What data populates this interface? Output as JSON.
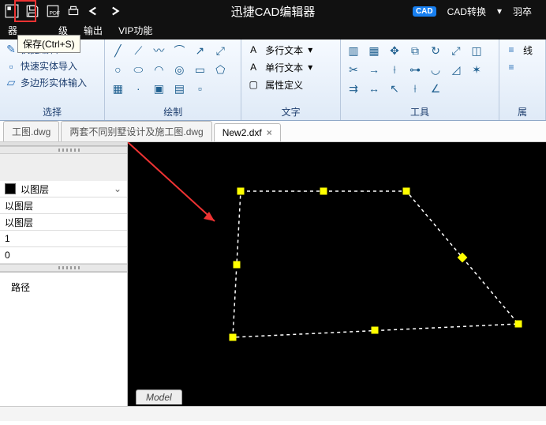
{
  "title": "迅捷CAD编辑器",
  "titlebar": {
    "cad_convert": "CAD转换",
    "user": "羽卒"
  },
  "tooltip": "保存(Ctrl+S)",
  "menu": {
    "m2_partial": "级",
    "m3": "输出",
    "m4": "VIP功能"
  },
  "ribbon": {
    "select": {
      "r1": "快捷编辑",
      "r2": "快速实体导入",
      "r3": "多边形实体输入",
      "label": "选择"
    },
    "draw": {
      "label": "绘制"
    },
    "text": {
      "r1": "多行文本",
      "r2": "单行文本",
      "r3": "属性定义",
      "label": "文字"
    },
    "tools": {
      "label": "工具"
    },
    "prop": {
      "r1": "线",
      "label": "属"
    }
  },
  "tabs": {
    "t1": "工图.dwg",
    "t2": "两套不同别墅设计及施工图.dwg",
    "t3": "New2.dxf"
  },
  "side": {
    "layer_opt": "以图层",
    "rows": {
      "r1": "以图层",
      "r2": "以图层",
      "r3": "1",
      "r4": "0"
    },
    "path_label": "路径"
  },
  "footer": {
    "model": "Model"
  }
}
